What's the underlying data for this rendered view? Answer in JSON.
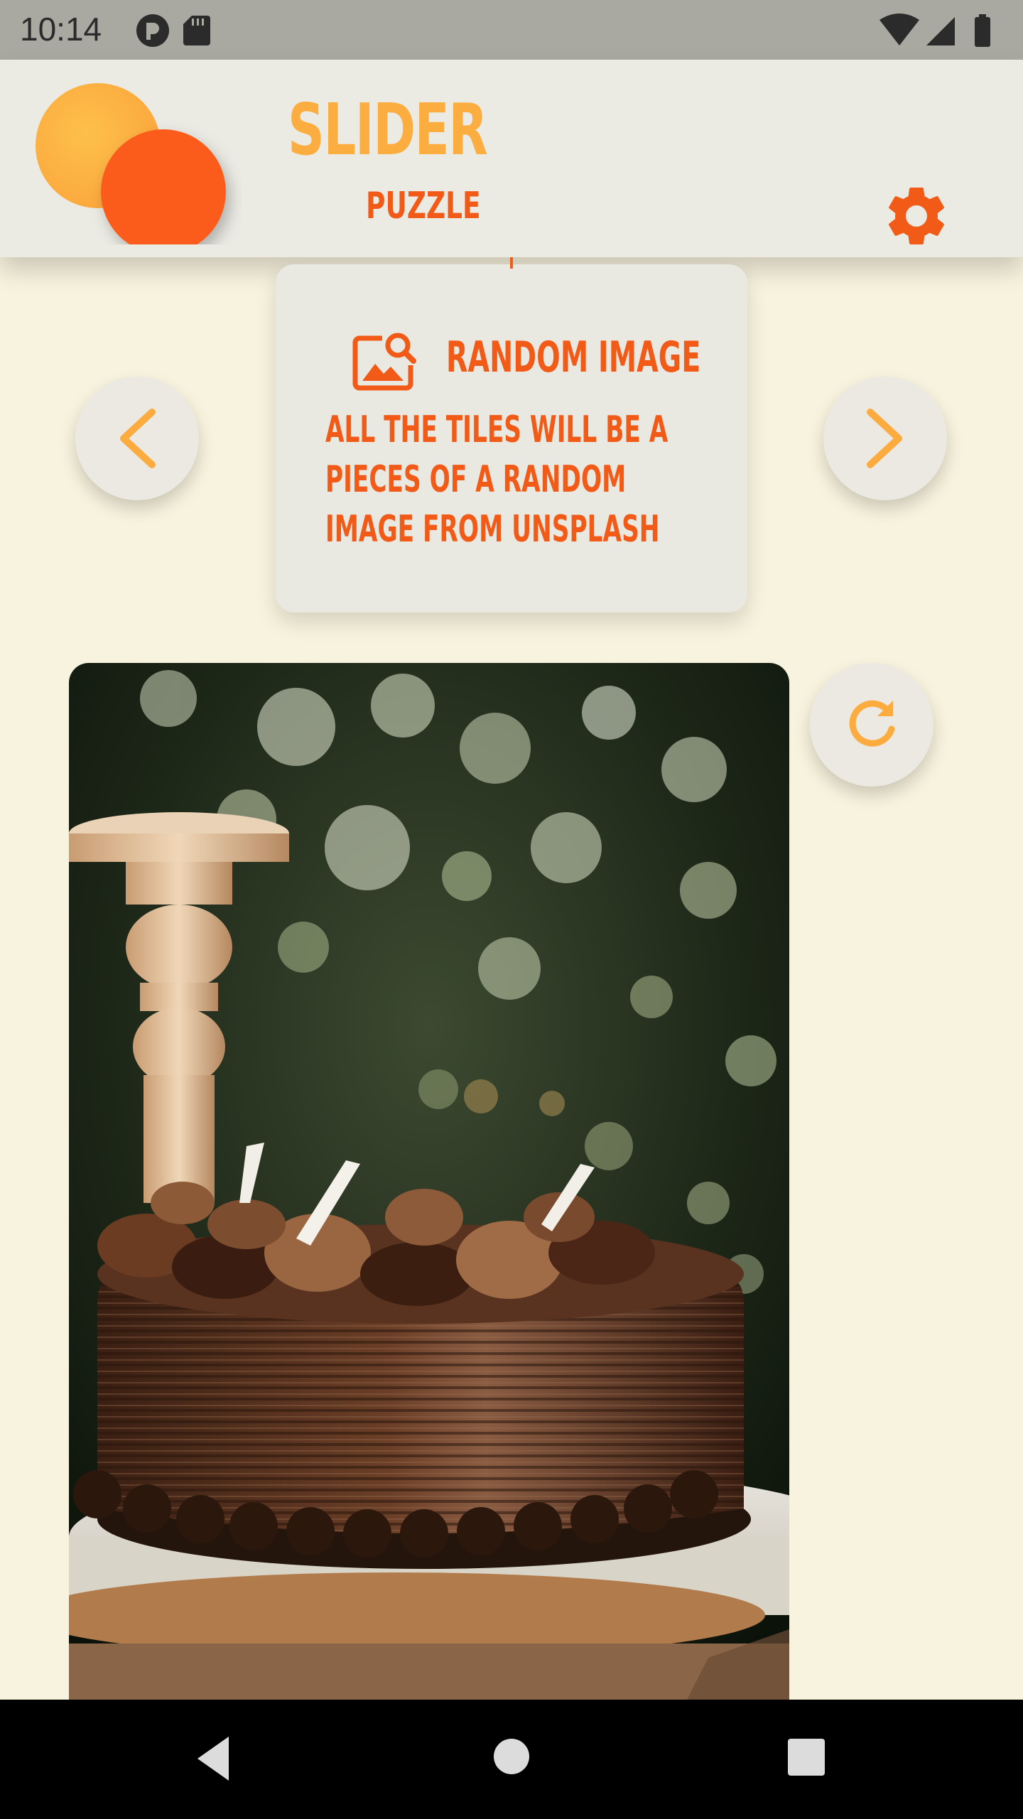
{
  "status_bar": {
    "time": "10:14",
    "left_icons": [
      "sync-icon",
      "sd-card-icon"
    ],
    "right_icons": [
      "wifi-icon",
      "cellular-icon",
      "battery-icon"
    ]
  },
  "header": {
    "title": "SLIDER",
    "subtitle": "PUZZLE",
    "logo": "two-circles-logo",
    "settings_icon": "gear-icon"
  },
  "mode_card": {
    "icon": "image-search-icon",
    "title": "RANDOM IMAGE",
    "description": "ALL THE TILES WILL BE A PIECES OF A RANDOM IMAGE FROM UNSPLASH"
  },
  "navigation": {
    "previous_icon": "chevron-left-icon",
    "next_icon": "chevron-right-icon",
    "refresh_icon": "refresh-icon"
  },
  "puzzle_image": {
    "subject": "chocolate cake photo"
  },
  "system_nav": {
    "back_icon": "back-triangle-icon",
    "home_icon": "home-circle-icon",
    "recents_icon": "recents-square-icon"
  },
  "colors": {
    "primary_orange": "#f25a17",
    "light_orange": "#fcad40",
    "background": "#f8f3de",
    "surface": "#ebeae3"
  }
}
